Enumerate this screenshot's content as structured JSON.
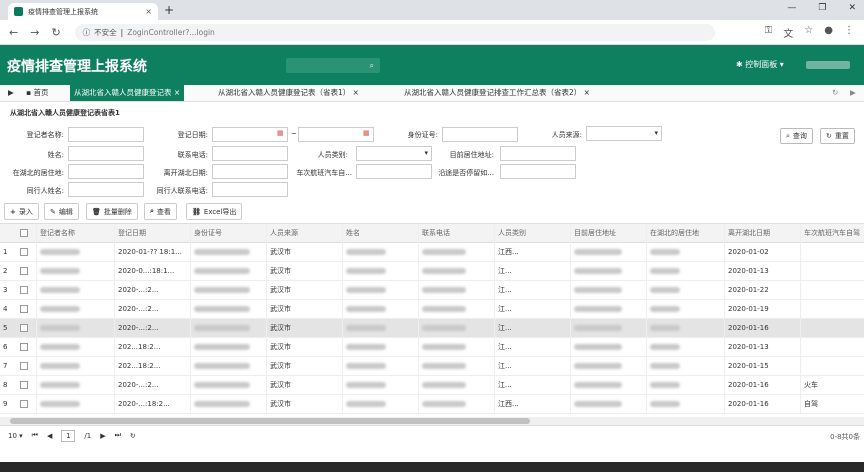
{
  "browser": {
    "tab_title": "疫情排查管理上报系统",
    "tab_close": "×",
    "new_tab": "+",
    "insecure": "不安全",
    "url": "ZoginController?...login",
    "win_min": "—",
    "win_max": "❐",
    "win_close": "✕"
  },
  "header": {
    "title": "疫情排查管理上报系统",
    "search_icon": "⌕",
    "control_panel": "控制面板 ▾",
    "control_icon": "✱"
  },
  "tabs": [
    {
      "label": "首页"
    },
    {
      "label": "从湖北省入赣人员健康登记表 ×"
    },
    {
      "label": "从湖北省入赣人员健康登记表（省表1）  ×"
    },
    {
      "label": "从湖北省入赣人员健康登记排查工作汇总表（省表2）  ×"
    }
  ],
  "page_heading": "从湖北省入赣人员健康登记表省表1",
  "filters": {
    "registrant": "登记者名称:",
    "reg_date": "登记日期:",
    "range_sep": "~",
    "id_no": "身份证号:",
    "source": "人员来源:",
    "name": "姓名:",
    "phone": "联系电话:",
    "category": "人员类别:",
    "address": "目前居住地址:",
    "hubei_addr": "在湖北的居住地:",
    "leave_date": "离开湖北日期:",
    "vehicle": "车次航班汽车自...",
    "stops": "沿途是否停留如...",
    "companion": "同行人姓名:",
    "companion_phone": "同行人联系电话:",
    "query": "查询",
    "reset": "重置"
  },
  "toolbar": {
    "add": "录入",
    "edit": "编辑",
    "batch_delete": "批量删除",
    "view": "查看",
    "export": "Excel导出"
  },
  "table": {
    "columns": [
      "登记者名称",
      "登记日期",
      "身份证号",
      "人员来源",
      "姓名",
      "联系电话",
      "人员类别",
      "目前居住地址",
      "在湖北的居住地",
      "离开湖北日期",
      "车次航班汽车自驾"
    ],
    "rows": [
      {
        "no": "1",
        "reg_date": "2020-01-?? 18:1...",
        "source": "武汉市",
        "category": "江西...",
        "leave": "2020-01-02",
        "vehicle": ""
      },
      {
        "no": "2",
        "reg_date": "2020-0...:18:1...",
        "source": "武汉市",
        "category": "江...",
        "leave": "2020-01-13",
        "vehicle": ""
      },
      {
        "no": "3",
        "reg_date": "2020-...:2...",
        "source": "武汉市",
        "category": "江...",
        "leave": "2020-01-22",
        "vehicle": ""
      },
      {
        "no": "4",
        "reg_date": "2020-...:2...",
        "source": "武汉市",
        "category": "江...",
        "leave": "2020-01-19",
        "vehicle": ""
      },
      {
        "no": "5",
        "reg_date": "2020-...:2...",
        "source": "武汉市",
        "category": "江...",
        "leave": "2020-01-16",
        "vehicle": ""
      },
      {
        "no": "6",
        "reg_date": "202...18:2...",
        "source": "武汉市",
        "category": "江...",
        "leave": "2020-01-13",
        "vehicle": ""
      },
      {
        "no": "7",
        "reg_date": "202...18:2...",
        "source": "武汉市",
        "category": "江...",
        "leave": "2020-01-15",
        "vehicle": ""
      },
      {
        "no": "8",
        "reg_date": "2020-...:2...",
        "source": "武汉市",
        "category": "江...",
        "leave": "2020-01-16",
        "vehicle": "火车"
      },
      {
        "no": "9",
        "reg_date": "2020-...:18:2...",
        "source": "武汉市",
        "category": "江西...",
        "leave": "2020-01-16",
        "vehicle": "自驾"
      }
    ]
  },
  "pager": {
    "page_size": "10",
    "page_no": "1",
    "of": "/1",
    "info": "0-8共0条"
  }
}
